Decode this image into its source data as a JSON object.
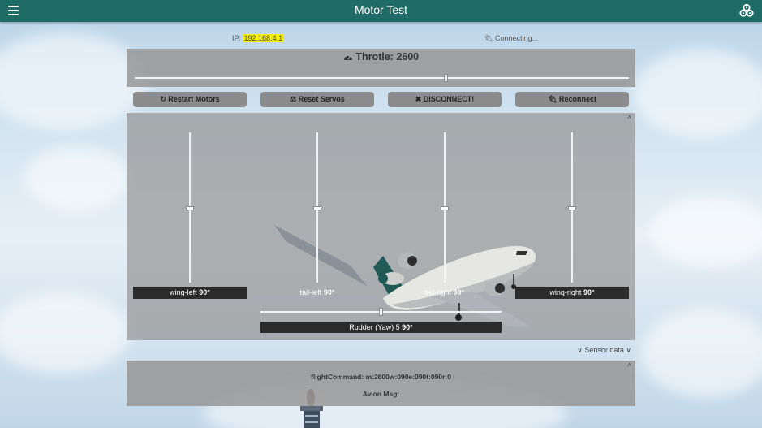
{
  "header": {
    "title": "Motor Test",
    "menu_icon": "hamburger-menu-icon",
    "logo_icon": "cogs-logo-icon",
    "bar_color": "#1f6b66"
  },
  "status": {
    "ip_label": "IP:",
    "ip_value": "192.168.4.1",
    "ip_highlight_color": "#f4f000",
    "connection_icon": "plug-icon",
    "connection_text": "Connecting..."
  },
  "throttle": {
    "icon": "dashboard-gauge-icon",
    "label": "Throtle: 2600",
    "value": 2600,
    "position_fraction": 0.63
  },
  "buttons": [
    {
      "label": "Restart Motors",
      "icon": "refresh-icon"
    },
    {
      "label": "Reset Servos",
      "icon": "balance-scale-icon"
    },
    {
      "label": "DISCONNECT!",
      "icon": "close-icon"
    },
    {
      "label": "Reconnect",
      "icon": "plug-icon"
    }
  ],
  "servos": [
    {
      "name": "wing-left ",
      "angle": "90°",
      "position_fraction": 0.5
    },
    {
      "name": "tail-left ",
      "angle": "90°",
      "position_fraction": 0.5
    },
    {
      "name": "tail-right ",
      "angle": "90°",
      "position_fraction": 0.5
    },
    {
      "name": "wing-right ",
      "angle": "90°",
      "position_fraction": 0.5
    }
  ],
  "rudder": {
    "name": "Rudder (Yaw) 5 ",
    "angle": "90°",
    "position_fraction": 0.5
  },
  "sensor_toggle": {
    "label": " Sensor data ",
    "icon": "double-chevron-down-icon"
  },
  "info": {
    "flight_command": "flightCommand: m:2600w:090e:090t:090r:0",
    "avion_msg": "Avion Msg:"
  }
}
